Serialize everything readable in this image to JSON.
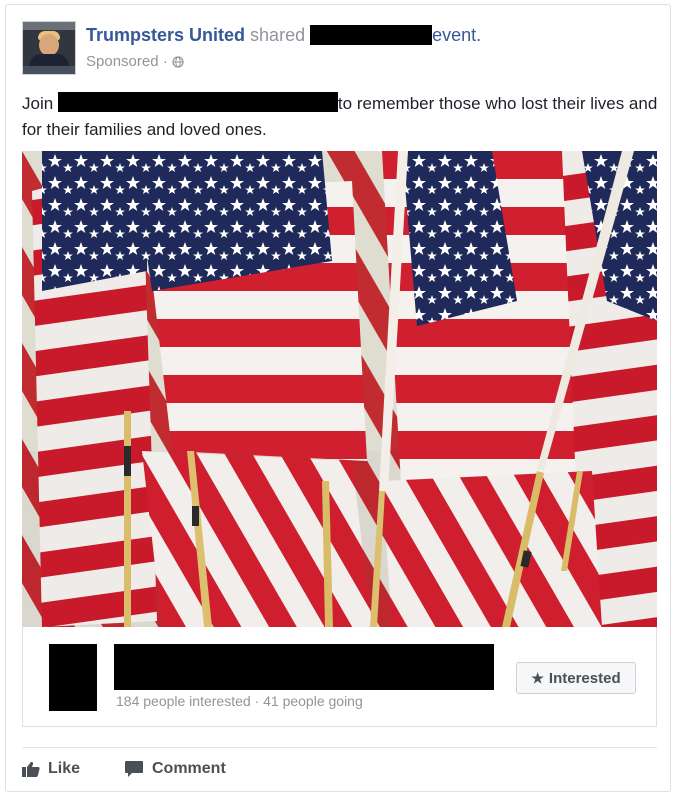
{
  "post": {
    "page_name": "Trumpsters United",
    "shared_text": "shared",
    "event_text": "event.",
    "sponsored": "Sponsored · ",
    "body_prefix": "Join",
    "body_rest": "to remember those who lost their lives and for their families and loved ones."
  },
  "event": {
    "stats": "184 people interested · 41 people going",
    "interested_label": "Interested"
  },
  "actions": {
    "like": "Like",
    "comment": "Comment"
  },
  "icons": {
    "globe": "globe-icon",
    "star": "star-icon",
    "like": "thumbs-up-icon",
    "comment": "comment-icon"
  },
  "colors": {
    "link": "#365899",
    "muted": "#90949c",
    "flag_red": "#d01f2f",
    "flag_blue": "#1f2a5a"
  }
}
